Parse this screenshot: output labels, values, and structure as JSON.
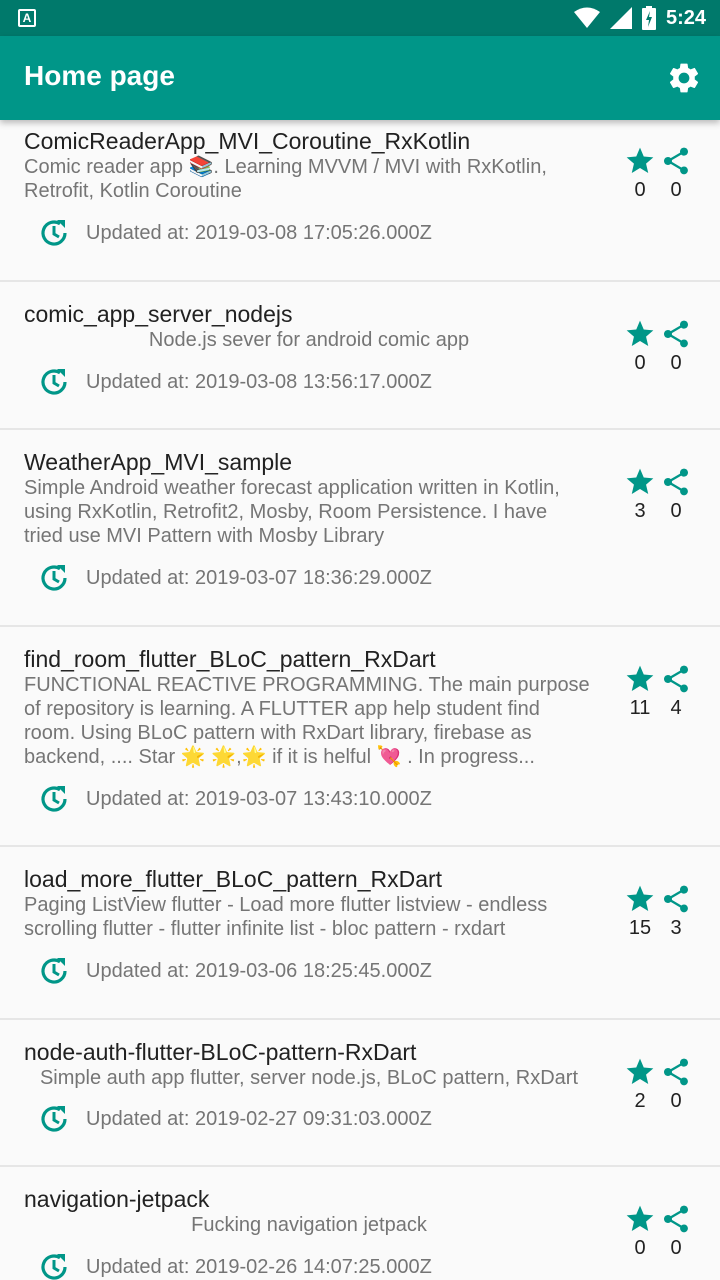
{
  "status_bar": {
    "time": "5:24",
    "left_icon_letter": "A"
  },
  "app_bar": {
    "title": "Home page",
    "settings_icon": "gear-icon"
  },
  "colors": {
    "primary": "#009688",
    "primary_dark": "#00796b"
  },
  "repos": [
    {
      "name": "ComicReaderApp_MVI_Coroutine_RxKotlin",
      "description": "Comic reader app 📚. Learning MVVM / MVI with RxKotlin,\nRetrofit, Kotlin Coroutine",
      "updated": "Updated at: 2019-03-08 17:05:26.000Z",
      "stars": "0",
      "forks": "0"
    },
    {
      "name": "comic_app_server_nodejs",
      "description": "Node.js sever for android comic app",
      "updated": "Updated at: 2019-03-08 13:56:17.000Z",
      "stars": "0",
      "forks": "0"
    },
    {
      "name": "WeatherApp_MVI_sample",
      "description": "Simple Android weather forecast application written in Kotlin,\nusing RxKotlin, Retrofit2, Mosby, Room Persistence. I have\ntried use MVI Pattern with Mosby Library",
      "updated": "Updated at: 2019-03-07 18:36:29.000Z",
      "stars": "3",
      "forks": "0"
    },
    {
      "name": "find_room_flutter_BLoC_pattern_RxDart",
      "description": "FUNCTIONAL REACTIVE PROGRAMMING. The main purpose\nof repository is learning. A FLUTTER app help student find\nroom. Using BLoC pattern with RxDart library, firebase as\nbackend, .... Star 🌟 🌟,🌟 if it is helful 💘 . In progress...",
      "updated": "Updated at: 2019-03-07 13:43:10.000Z",
      "stars": "11",
      "forks": "4"
    },
    {
      "name": "load_more_flutter_BLoC_pattern_RxDart",
      "description": "Paging ListView flutter - Load more flutter listview - endless\nscrolling flutter - flutter infinite list - bloc pattern - rxdart",
      "updated": "Updated at: 2019-03-06 18:25:45.000Z",
      "stars": "15",
      "forks": "3"
    },
    {
      "name": "node-auth-flutter-BLoC-pattern-RxDart",
      "description": "Simple auth app flutter, server node.js, BLoC pattern, RxDart",
      "updated": "Updated at: 2019-02-27 09:31:03.000Z",
      "stars": "2",
      "forks": "0"
    },
    {
      "name": "navigation-jetpack",
      "description": "Fucking navigation jetpack",
      "updated": "Updated at: 2019-02-26 14:07:25.000Z",
      "stars": "0",
      "forks": "0"
    }
  ]
}
